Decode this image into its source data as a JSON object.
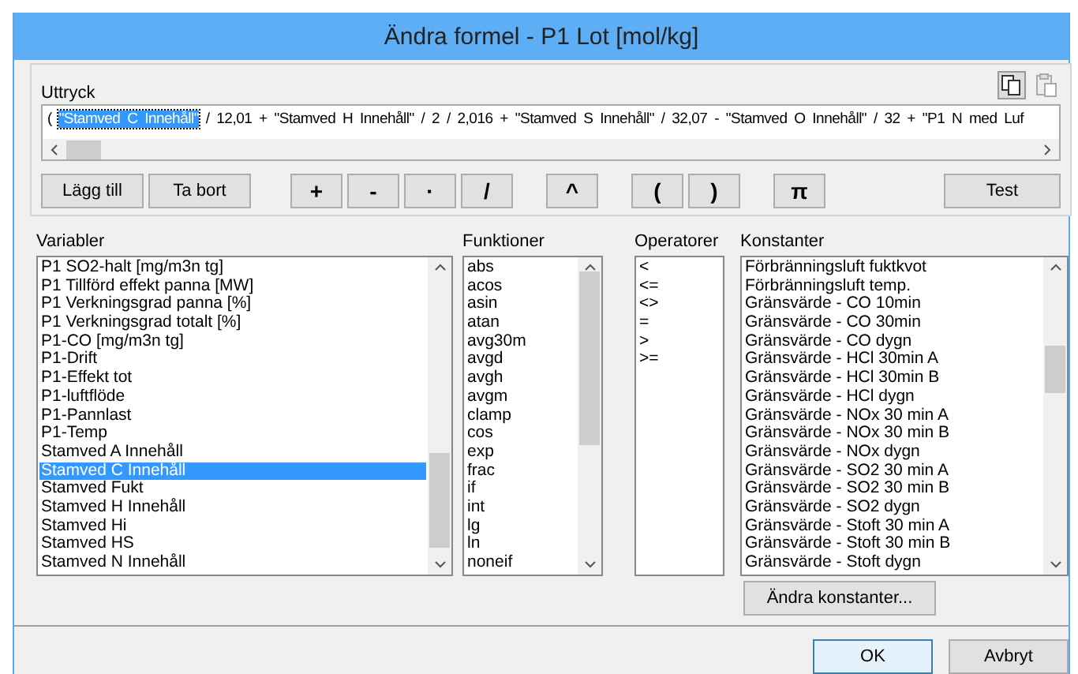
{
  "window": {
    "title": "Ändra formel - P1 Lot [mol/kg]"
  },
  "expression": {
    "label": "Uttryck",
    "parts": [
      {
        "text": "( ",
        "selected": false
      },
      {
        "text": "\"Stamved C Innehåll\"",
        "selected": true
      },
      {
        "text": " / 12,01 + \"Stamved H Innehåll\" / 2 / 2,016 + \"Stamved S Innehåll\" / 32,07 - \"Stamved O Innehåll\" / 32 + \"P1 N med Luf",
        "selected": false
      }
    ]
  },
  "buttons": [
    {
      "label": "Lägg till",
      "kind": "action"
    },
    {
      "label": "Ta bort",
      "kind": "action"
    },
    {
      "label": "+",
      "kind": "op"
    },
    {
      "label": "-",
      "kind": "op"
    },
    {
      "label": "·",
      "kind": "op"
    },
    {
      "label": "/",
      "kind": "op"
    },
    {
      "label": "^",
      "kind": "op"
    },
    {
      "label": "(",
      "kind": "op"
    },
    {
      "label": ")",
      "kind": "op"
    },
    {
      "label": "π",
      "kind": "op"
    },
    {
      "label": "Test",
      "kind": "test"
    }
  ],
  "lists": [
    {
      "label": "Variabler",
      "kind": "wide",
      "items": [
        {
          "text": "P1 SO2-halt [mg/m3n tg]",
          "selected": false
        },
        {
          "text": "P1 Tillförd effekt panna [MW]",
          "selected": false
        },
        {
          "text": "P1 Verkningsgrad panna [%]",
          "selected": false
        },
        {
          "text": "P1 Verkningsgrad totalt [%]",
          "selected": false
        },
        {
          "text": "P1-CO [mg/m3n tg]",
          "selected": false
        },
        {
          "text": "P1-Drift",
          "selected": false
        },
        {
          "text": "P1-Effekt tot",
          "selected": false
        },
        {
          "text": "P1-luftflöde",
          "selected": false
        },
        {
          "text": "P1-Pannlast",
          "selected": false
        },
        {
          "text": "P1-Temp",
          "selected": false
        },
        {
          "text": "Stamved A Innehåll",
          "selected": false
        },
        {
          "text": "Stamved C Innehåll",
          "selected": true
        },
        {
          "text": "Stamved Fukt",
          "selected": false
        },
        {
          "text": "Stamved H Innehåll",
          "selected": false
        },
        {
          "text": "Stamved Hi",
          "selected": false
        },
        {
          "text": "Stamved HS",
          "selected": false
        },
        {
          "text": "Stamved N Innehåll",
          "selected": false
        }
      ]
    },
    {
      "label": "Funktioner",
      "kind": "func",
      "items": [
        {
          "text": "abs",
          "selected": false
        },
        {
          "text": "acos",
          "selected": false
        },
        {
          "text": "asin",
          "selected": false
        },
        {
          "text": "atan",
          "selected": false
        },
        {
          "text": "avg30m",
          "selected": false
        },
        {
          "text": "avgd",
          "selected": false
        },
        {
          "text": "avgh",
          "selected": false
        },
        {
          "text": "avgm",
          "selected": false
        },
        {
          "text": "clamp",
          "selected": false
        },
        {
          "text": "cos",
          "selected": false
        },
        {
          "text": "exp",
          "selected": false
        },
        {
          "text": "frac",
          "selected": false
        },
        {
          "text": "if",
          "selected": false
        },
        {
          "text": "int",
          "selected": false
        },
        {
          "text": "lg",
          "selected": false
        },
        {
          "text": "ln",
          "selected": false
        },
        {
          "text": "noneif",
          "selected": false
        }
      ]
    },
    {
      "label": "Operatorer",
      "kind": "ops",
      "items": [
        {
          "text": "<",
          "selected": false
        },
        {
          "text": "<=",
          "selected": false
        },
        {
          "text": "<>",
          "selected": false
        },
        {
          "text": "=",
          "selected": false
        },
        {
          "text": ">",
          "selected": false
        },
        {
          "text": ">=",
          "selected": false
        }
      ]
    },
    {
      "label": "Konstanter",
      "kind": "const",
      "items": [
        {
          "text": "Förbränningsluft fuktkvot",
          "selected": false
        },
        {
          "text": "Förbränningsluft temp.",
          "selected": false
        },
        {
          "text": "Gränsvärde - CO 10min",
          "selected": false
        },
        {
          "text": "Gränsvärde - CO 30min",
          "selected": false
        },
        {
          "text": "Gränsvärde - CO dygn",
          "selected": false
        },
        {
          "text": "Gränsvärde - HCl 30min A",
          "selected": false
        },
        {
          "text": "Gränsvärde - HCl 30min B",
          "selected": false
        },
        {
          "text": "Gränsvärde - HCl dygn",
          "selected": false
        },
        {
          "text": "Gränsvärde - NOx 30 min A",
          "selected": false
        },
        {
          "text": "Gränsvärde - NOx 30 min B",
          "selected": false
        },
        {
          "text": "Gränsvärde - NOx dygn",
          "selected": false
        },
        {
          "text": "Gränsvärde - SO2 30 min A",
          "selected": false
        },
        {
          "text": "Gränsvärde - SO2 30 min B",
          "selected": false
        },
        {
          "text": "Gränsvärde - SO2 dygn",
          "selected": false
        },
        {
          "text": "Gränsvärde - Stoft 30 min A",
          "selected": false
        },
        {
          "text": "Gränsvärde - Stoft 30 min B",
          "selected": false
        },
        {
          "text": "Gränsvärde - Stoft dygn",
          "selected": false
        }
      ]
    }
  ],
  "edit_constants_button": "Ändra konstanter...",
  "footer_buttons": [
    {
      "label": "OK",
      "default": true
    },
    {
      "label": "Avbryt",
      "default": false
    }
  ]
}
